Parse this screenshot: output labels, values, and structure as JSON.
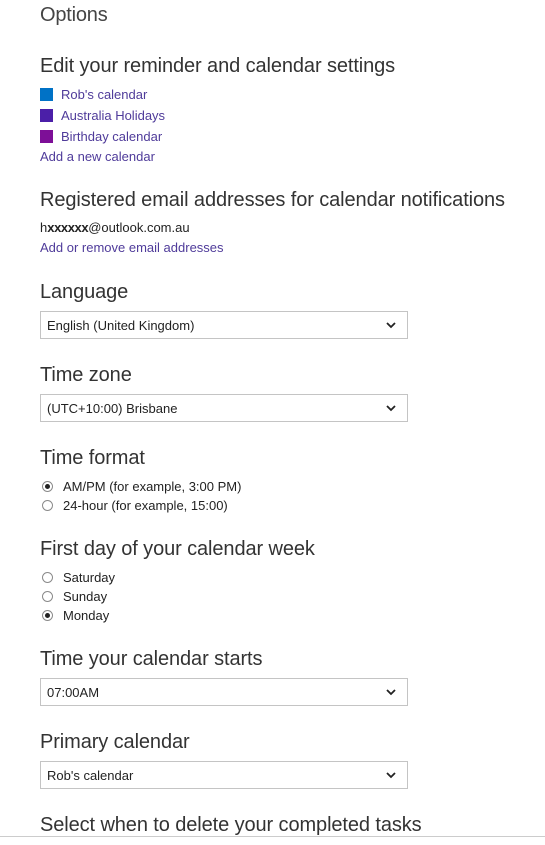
{
  "page": {
    "title": "Options"
  },
  "calendars_section": {
    "title": "Edit your reminder and calendar settings",
    "items": [
      {
        "label": "Rob's calendar",
        "color": "#0072c6"
      },
      {
        "label": "Australia Holidays",
        "color": "#4b1fa8"
      },
      {
        "label": "Birthday calendar",
        "color": "#7d0f97"
      }
    ],
    "add_link": "Add a new calendar"
  },
  "email_section": {
    "title": "Registered email addresses for calendar notifications",
    "email_prefix": "h",
    "email_masked": "xxxxxx",
    "email_domain": "@outlook.com.au",
    "manage_link": "Add or remove email addresses"
  },
  "language": {
    "title": "Language",
    "selected": "English (United Kingdom)"
  },
  "time_zone": {
    "title": "Time zone",
    "selected": "(UTC+10:00) Brisbane"
  },
  "time_format": {
    "title": "Time format",
    "options": [
      {
        "label": "AM/PM (for example, 3:00 PM)",
        "checked": true
      },
      {
        "label": "24-hour (for example, 15:00)",
        "checked": false
      }
    ]
  },
  "first_day": {
    "title": "First day of your calendar week",
    "options": [
      {
        "label": "Saturday",
        "checked": false
      },
      {
        "label": "Sunday",
        "checked": false
      },
      {
        "label": "Monday",
        "checked": true
      }
    ]
  },
  "calendar_start": {
    "title": "Time your calendar starts",
    "selected": "07:00AM"
  },
  "primary_calendar": {
    "title": "Primary calendar",
    "selected": "Rob's calendar"
  },
  "delete_tasks": {
    "title": "Select when to delete your completed tasks"
  },
  "icons": {
    "dropdown": "chevron-down-icon",
    "radio_checked": "radio-checked",
    "radio_unchecked": "radio-unchecked"
  }
}
